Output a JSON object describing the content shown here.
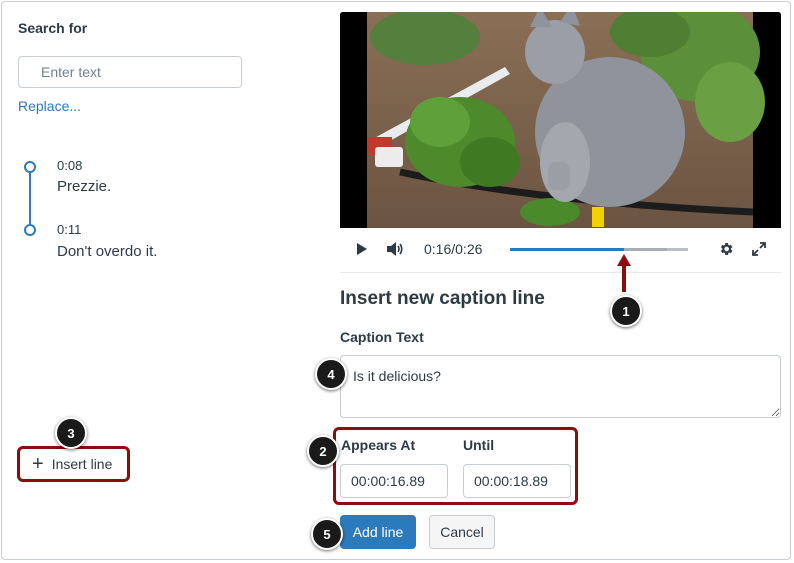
{
  "left_panel": {
    "search_label": "Search for",
    "search_placeholder": "Enter text",
    "search_value": "",
    "replace_link": "Replace...",
    "captions": [
      {
        "time": "0:08",
        "text": "Prezzie."
      },
      {
        "time": "0:11",
        "text": "Don't overdo it."
      }
    ],
    "insert_line_label": "Insert line"
  },
  "video": {
    "time_readout": "0:16/0:26",
    "progress_fraction": 0.64,
    "buffered_fraction": 0.88,
    "icons": [
      "play-icon",
      "volume-icon",
      "settings-gear-icon",
      "fullscreen-icon"
    ]
  },
  "form": {
    "heading": "Insert new caption line",
    "caption_label": "Caption Text",
    "caption_value": "Is it delicious?",
    "appears_at_label": "Appears At",
    "appears_at_value": "00:00:16.89",
    "until_label": "Until",
    "until_value": "00:00:18.89",
    "add_button": "Add line",
    "cancel_button": "Cancel"
  },
  "annotations": {
    "badges": [
      "1",
      "2",
      "3",
      "4",
      "5"
    ],
    "highlight_color": "#8b0d0d"
  },
  "colors": {
    "accent": "#2b7abc",
    "text": "#2d3b45"
  }
}
